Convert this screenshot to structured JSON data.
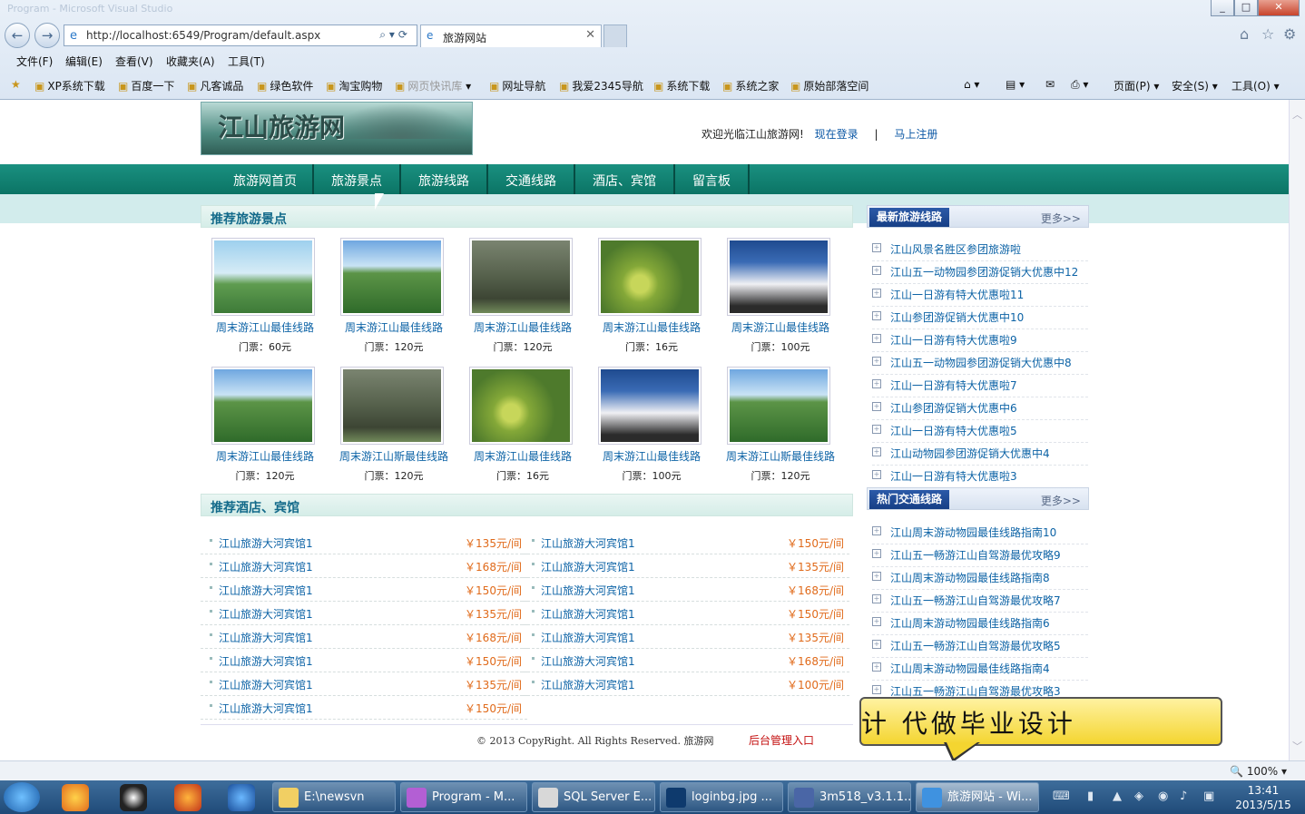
{
  "browser": {
    "window_title": "Program - Microsoft Visual Studio",
    "url": "http://localhost:6549/Program/default.aspx",
    "tab_title": "旅游网站",
    "menu": [
      "文件(F)",
      "编辑(E)",
      "查看(V)",
      "收藏夹(A)",
      "工具(T)"
    ],
    "favorites": [
      "XP系统下载",
      "百度一下",
      "凡客诚品",
      "绿色软件",
      "淘宝购物",
      "网页快讯库",
      "网址导航",
      "我爱2345导航",
      "系统下载",
      "系统之家",
      "原始部落空间"
    ],
    "cmd": [
      "页面(P)",
      "安全(S)",
      "工具(O)"
    ],
    "zoom": "100%"
  },
  "site": {
    "logo_text": "江山旅游网",
    "welcome": "欢迎光临江山旅游网!",
    "login": "现在登录",
    "divider": "|",
    "register": "马上注册",
    "nav": [
      "旅游网首页",
      "旅游景点",
      "旅游线路",
      "交通线路",
      "酒店、宾馆",
      "留言板"
    ]
  },
  "spots": {
    "title": "推荐旅游景点",
    "items": [
      {
        "name": "周末游江山最佳线路",
        "price": "门票：60元",
        "img": "lake"
      },
      {
        "name": "周末游江山最佳线路",
        "price": "门票：120元",
        "img": "lotus"
      },
      {
        "name": "周末游江山最佳线路",
        "price": "门票：120元",
        "img": "gate"
      },
      {
        "name": "周末游江山最佳线路",
        "price": "门票：16元",
        "img": "pear"
      },
      {
        "name": "周末游江山最佳线路",
        "price": "门票：100元",
        "img": "cloud"
      },
      {
        "name": "周末游江山最佳线路",
        "price": "门票：120元",
        "img": "lotus"
      },
      {
        "name": "周末游江山斯最佳线路",
        "price": "门票：120元",
        "img": "gate"
      },
      {
        "name": "周末游江山最佳线路",
        "price": "门票：16元",
        "img": "pear"
      },
      {
        "name": "周末游江山最佳线路",
        "price": "门票：100元",
        "img": "cloud"
      },
      {
        "name": "周末游江山斯最佳线路",
        "price": "门票：120元",
        "img": "lotus"
      }
    ]
  },
  "hotels": {
    "title": "推荐酒店、宾馆",
    "left": [
      {
        "name": "江山旅游大河宾馆1",
        "price": "￥135元/间"
      },
      {
        "name": "江山旅游大河宾馆1",
        "price": "￥168元/间"
      },
      {
        "name": "江山旅游大河宾馆1",
        "price": "￥150元/间"
      },
      {
        "name": "江山旅游大河宾馆1",
        "price": "￥135元/间"
      },
      {
        "name": "江山旅游大河宾馆1",
        "price": "￥168元/间"
      },
      {
        "name": "江山旅游大河宾馆1",
        "price": "￥150元/间"
      },
      {
        "name": "江山旅游大河宾馆1",
        "price": "￥135元/间"
      },
      {
        "name": "江山旅游大河宾馆1",
        "price": "￥150元/间"
      }
    ],
    "right": [
      {
        "name": "江山旅游大河宾馆1",
        "price": "￥150元/间"
      },
      {
        "name": "江山旅游大河宾馆1",
        "price": "￥135元/间"
      },
      {
        "name": "江山旅游大河宾馆1",
        "price": "￥168元/间"
      },
      {
        "name": "江山旅游大河宾馆1",
        "price": "￥150元/间"
      },
      {
        "name": "江山旅游大河宾馆1",
        "price": "￥135元/间"
      },
      {
        "name": "江山旅游大河宾馆1",
        "price": "￥168元/间"
      },
      {
        "name": "江山旅游大河宾馆1",
        "price": "￥100元/间"
      }
    ]
  },
  "routes": {
    "title": "最新旅游线路",
    "more": "更多>>",
    "items": [
      "江山风景名胜区参团旅游啦",
      "江山五一动物园参团游促销大优惠中12",
      "江山一日游有特大优惠啦11",
      "江山参团游促销大优惠中10",
      "江山一日游有特大优惠啦9",
      "江山五一动物园参团游促销大优惠中8",
      "江山一日游有特大优惠啦7",
      "江山参团游促销大优惠中6",
      "江山一日游有特大优惠啦5",
      "江山动物园参团游促销大优惠中4",
      "江山一日游有特大优惠啦3"
    ]
  },
  "traffic": {
    "title": "热门交通线路",
    "more": "更多>>",
    "items": [
      "江山周末游动物园最佳线路指南10",
      "江山五一畅游江山自驾游最优攻略9",
      "江山周末游动物园最佳线路指南8",
      "江山五一畅游江山自驾游最优攻略7",
      "江山周末游动物园最佳线路指南6",
      "江山五一畅游江山自驾游最优攻略5",
      "江山周末游动物园最佳线路指南4",
      "江山五一畅游江山自驾游最优攻略3"
    ]
  },
  "footer": {
    "copyright": "© 2013 CopyRight. All Rights Reserved. 旅游网",
    "admin": "后台管理入口"
  },
  "overlay": {
    "callout": "计 代做毕业设计"
  },
  "taskbar": {
    "items": [
      "E:\\newsvn",
      "Program - M...",
      "SQL Server E...",
      "loginbg.jpg ...",
      "3m518_v3.1.1...",
      "旅游网站 - Wi..."
    ],
    "time": "13:41",
    "date": "2013/5/15"
  }
}
